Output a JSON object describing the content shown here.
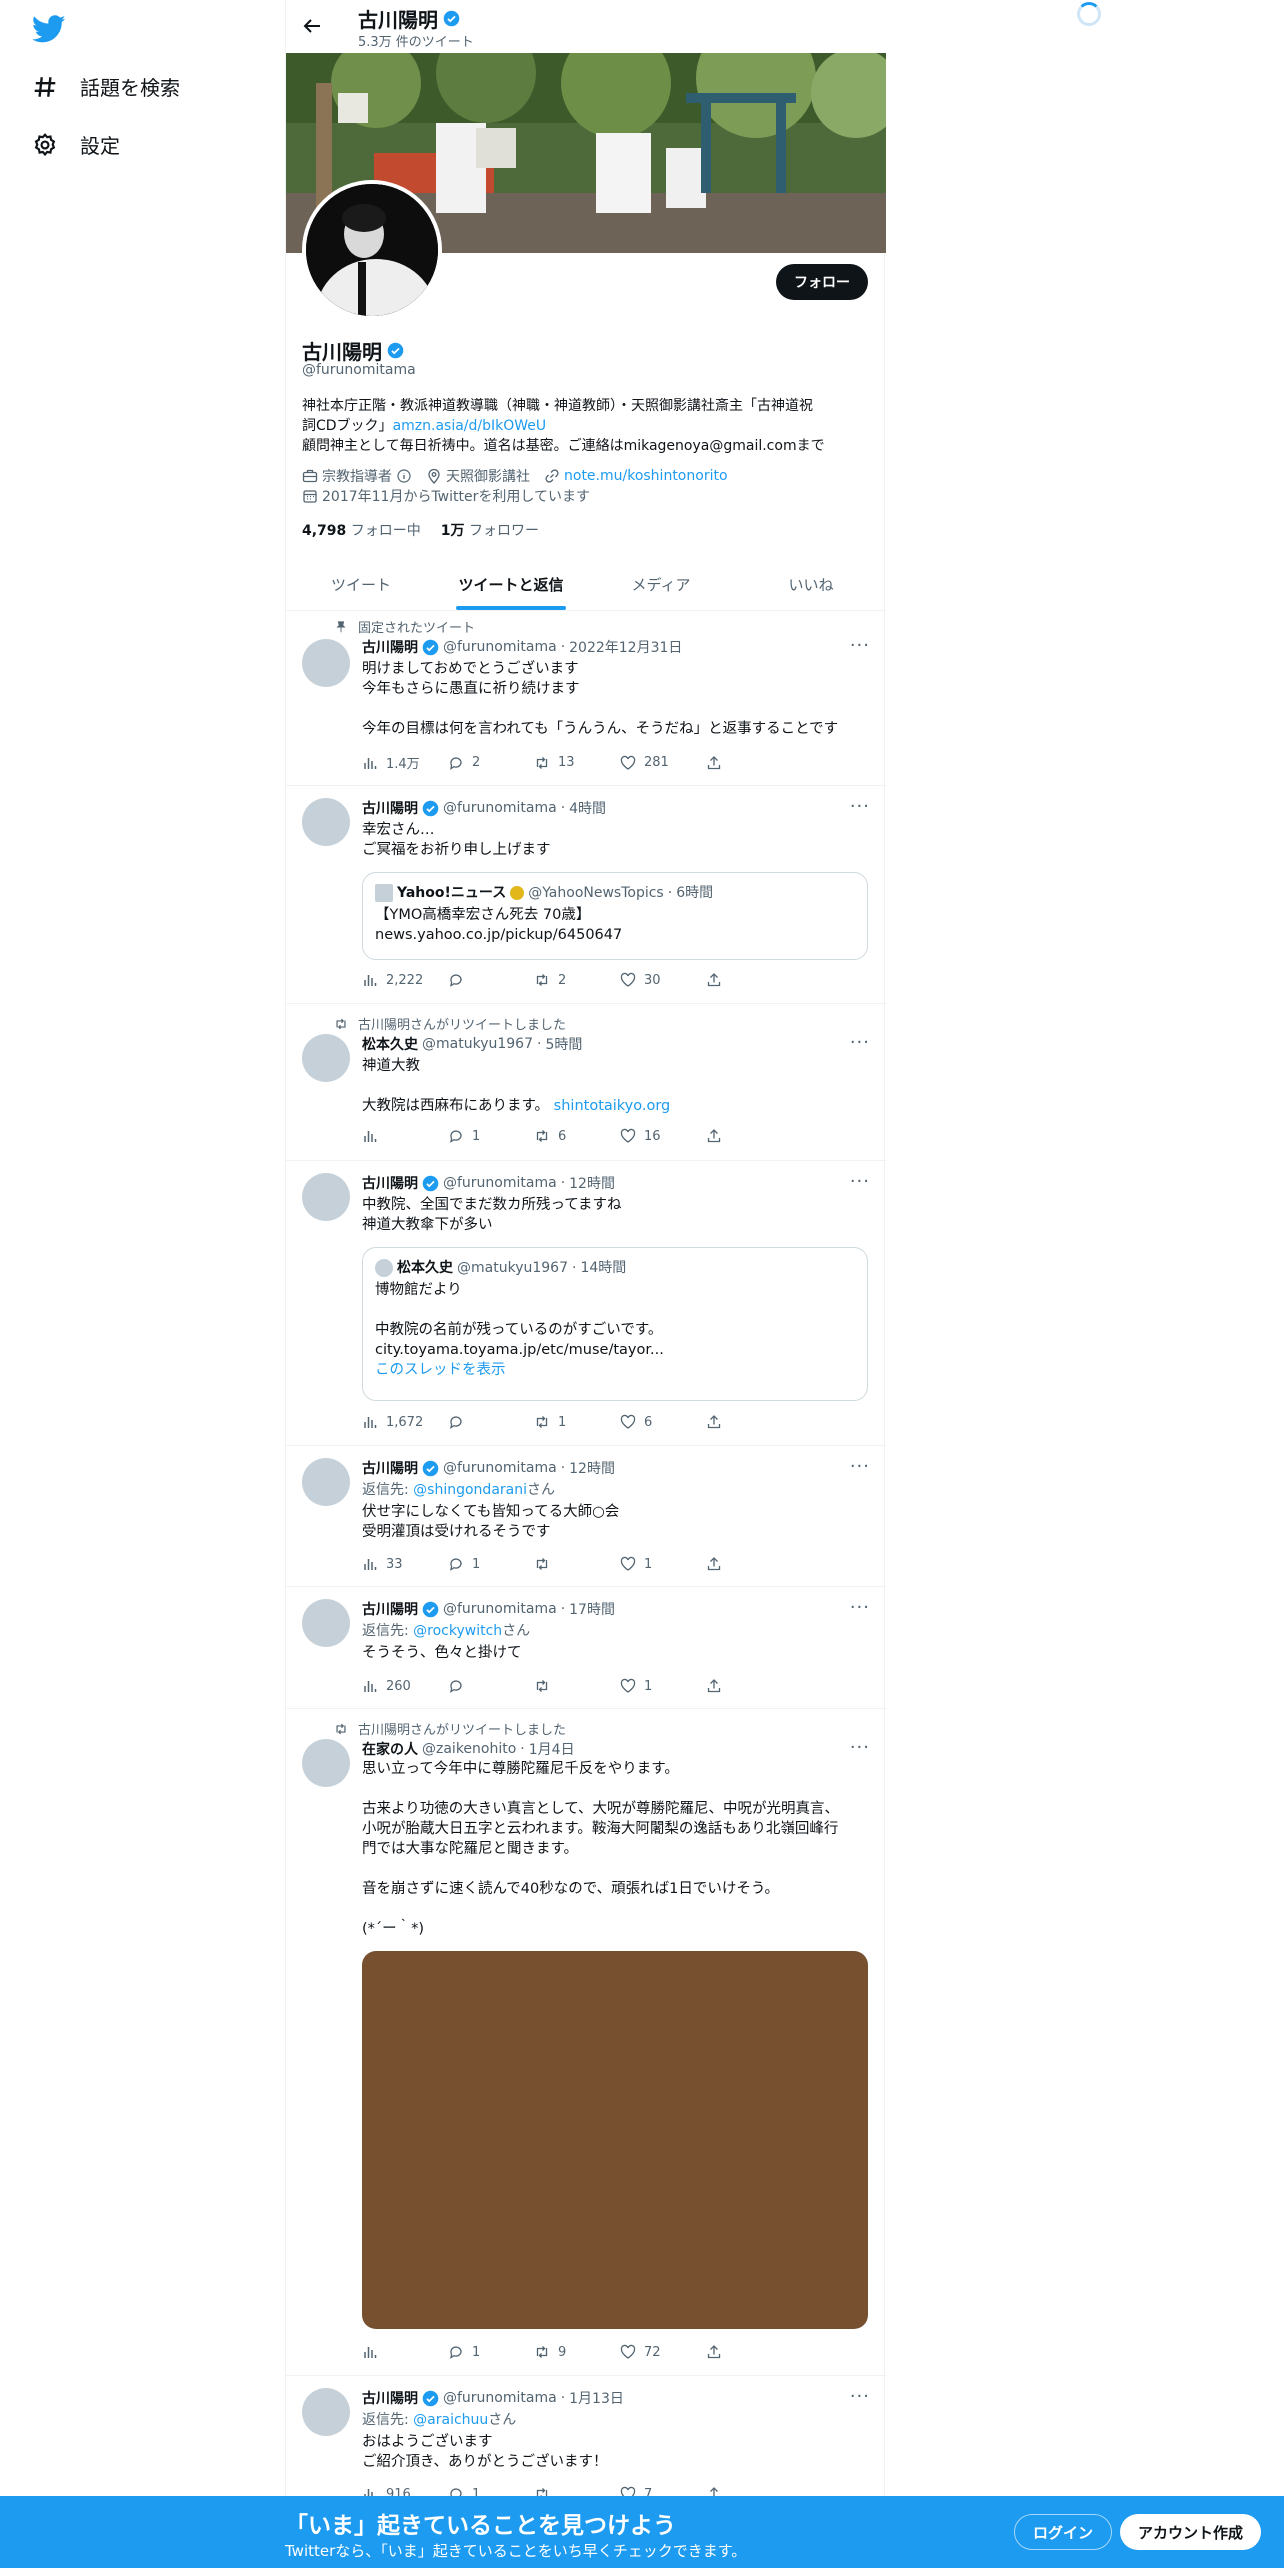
{
  "nav": {
    "explore": "話題を検索",
    "settings": "設定"
  },
  "header": {
    "name": "古川陽明",
    "tweet_count": "5.3万 件のツイート"
  },
  "profile": {
    "name": "古川陽明",
    "handle": "@furunomitama",
    "follow_label": "フォロー",
    "bio_line1": "神社本庁正階・教派神道教導職（神職・神道教師）・天照御影講社斎主「古神道祝",
    "bio_line2_text": "詞CDブック」",
    "bio_line2_link": "amzn.asia/d/bIkOWeU",
    "bio_line3": "顧問神主として毎日祈祷中。道名は基密。ご連絡はmikagenoya@gmail.comまで",
    "category": "宗教指導者",
    "location": "天照御影講社",
    "url": "note.mu/koshintonorito",
    "joined": "2017年11月からTwitterを利用しています",
    "following_count": "4,798",
    "following_label": "フォロー中",
    "followers_count": "1万",
    "followers_label": "フォロワー"
  },
  "tabs": [
    "ツイート",
    "ツイートと返信",
    "メディア",
    "いいね"
  ],
  "tweets": [
    {
      "context": "固定されたツイート",
      "name": "古川陽明",
      "handle": "@furunomitama",
      "time": "2022年12月31日",
      "text": "明けましておめでとうございます\n今年もさらに愚直に祈り続けます\n\n今年の目標は何を言われても「うんうん、そうだね」と返事することです",
      "views": "1.4万",
      "replies": "2",
      "retweets": "13",
      "likes": "281"
    },
    {
      "name": "古川陽明",
      "handle": "@furunomitama",
      "time": "4時間",
      "text": "幸宏さん…\nご冥福をお祈り申し上げます",
      "quote": {
        "name": "Yahoo!ニュース",
        "handle": "@YahooNewsTopics",
        "time": "6時間",
        "text": "【YMO高橋幸宏さん死去 70歳】\nnews.yahoo.co.jp/pickup/6450647"
      },
      "views": "2,222",
      "replies": "",
      "retweets": "2",
      "likes": "30"
    },
    {
      "context": "古川陽明さんがリツイートしました",
      "name": "松本久史",
      "handle": "@matukyu1967",
      "time": "5時間",
      "text": "神道大教\n\n大教院は西麻布にあります。",
      "link": "shintotaikyo.org",
      "views": "",
      "replies": "1",
      "retweets": "6",
      "likes": "16"
    },
    {
      "name": "古川陽明",
      "handle": "@furunomitama",
      "time": "12時間",
      "text": "中教院、全国でまだ数カ所残ってますね\n神道大教傘下が多い",
      "quote": {
        "name": "松本久史",
        "handle": "@matukyu1967",
        "time": "14時間",
        "text": "博物館だより\n\n中教院の名前が残っているのがすごいです。\ncity.toyama.toyama.jp/etc/muse/tayor...",
        "thread": "このスレッドを表示"
      },
      "views": "1,672",
      "replies": "",
      "retweets": "1",
      "likes": "6"
    },
    {
      "name": "古川陽明",
      "handle": "@furunomitama",
      "time": "12時間",
      "reply_prefix": "返信先: ",
      "reply_to": "@shingondarani",
      "reply_suffix": "さん",
      "text": "伏せ字にしなくても皆知ってる大師○会\n受明灌頂は受けれるそうです",
      "views": "33",
      "replies": "1",
      "retweets": "",
      "likes": "1"
    },
    {
      "name": "古川陽明",
      "handle": "@furunomitama",
      "time": "17時間",
      "reply_prefix": "返信先: ",
      "reply_to": "@rockywitch",
      "reply_suffix": "さん",
      "text": "そうそう、色々と掛けて",
      "views": "260",
      "replies": "",
      "retweets": "",
      "likes": "1"
    },
    {
      "context": "古川陽明さんがリツイートしました",
      "name": "在家の人",
      "handle": "@zaikenohito",
      "time": "1月4日",
      "text": "思い立って今年中に尊勝陀羅尼千反をやります。\n\n古来より功徳の大きい真言として、大呪が尊勝陀羅尼、中呪が光明真言、\n小呪が胎蔵大日五字と云われます。鞍海大阿闍梨の逸話もあり北嶺回峰行\n門では大事な陀羅尼と聞きます。\n\n音を崩さずに速く読んで40秒なので、頑張れば1日でいけそう。\n\n(*´ー｀*)",
      "views": "",
      "replies": "1",
      "retweets": "9",
      "likes": "72"
    },
    {
      "name": "古川陽明",
      "handle": "@furunomitama",
      "time": "1月13日",
      "reply_prefix": "返信先: ",
      "reply_to": "@araichuu",
      "reply_suffix": "さん",
      "text": "おはようございます\nご紹介頂き、ありがとうございます！",
      "views": "916",
      "replies": "1",
      "retweets": "",
      "likes": "7"
    }
  ],
  "bottom": {
    "title": "「いま」起きていることを見つけよう",
    "subtitle": "Twitterなら、「いま」起きていることをいち早くチェックできます。",
    "login": "ログイン",
    "signup": "アカウント作成"
  },
  "colors": {
    "accent": "#1d9bf0",
    "text": "#0f1419",
    "muted": "#536471"
  }
}
